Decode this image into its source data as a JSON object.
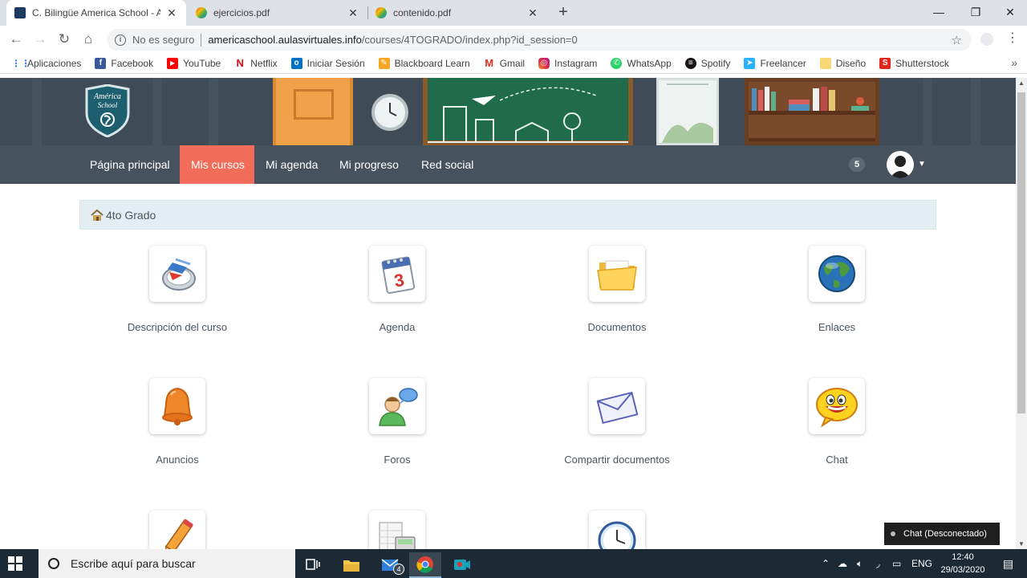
{
  "browser": {
    "tabs": [
      {
        "title": "C. Bilingüe America School - Ame",
        "active": true
      },
      {
        "title": "ejercicios.pdf",
        "active": false
      },
      {
        "title": "contenido.pdf",
        "active": false
      }
    ],
    "omnibox": {
      "security_label": "No es seguro",
      "host": "americaschool.aulasvirtuales.info",
      "path": "/courses/4TOGRADO/index.php?id_session=0"
    },
    "bookmarks": [
      {
        "label": "Aplicaciones",
        "icon": "apps-icon",
        "color": "#4285f4"
      },
      {
        "label": "Facebook",
        "icon": "facebook-icon",
        "color": "#3b5998"
      },
      {
        "label": "YouTube",
        "icon": "youtube-icon",
        "color": "#ff0000"
      },
      {
        "label": "Netflix",
        "icon": "netflix-icon",
        "color": "#e50914"
      },
      {
        "label": "Iniciar Sesión",
        "icon": "outlook-icon",
        "color": "#0072c6"
      },
      {
        "label": "Blackboard Learn",
        "icon": "blackboard-icon",
        "color": "#f5a623"
      },
      {
        "label": "Gmail",
        "icon": "gmail-icon",
        "color": "#d93025"
      },
      {
        "label": "Instagram",
        "icon": "instagram-icon",
        "color": "#c13584"
      },
      {
        "label": "WhatsApp",
        "icon": "whatsapp-icon",
        "color": "#25d366"
      },
      {
        "label": "Spotify",
        "icon": "spotify-icon",
        "color": "#191414"
      },
      {
        "label": "Freelancer",
        "icon": "freelancer-icon",
        "color": "#29b2fe"
      },
      {
        "label": "Diseño",
        "icon": "folder-icon",
        "color": "#f8d775"
      },
      {
        "label": "Shutterstock",
        "icon": "shutterstock-icon",
        "color": "#e1251b"
      }
    ]
  },
  "site": {
    "logo_text": "América School",
    "nav": [
      {
        "label": "Página principal",
        "active": false
      },
      {
        "label": "Mis cursos",
        "active": true
      },
      {
        "label": "Mi agenda",
        "active": false
      },
      {
        "label": "Mi progreso",
        "active": false
      },
      {
        "label": "Red social",
        "active": false
      }
    ],
    "notification_count": "5",
    "breadcrumb": "4to Grado",
    "tools": [
      {
        "label": "Descripción del curso",
        "icon": "compass-icon"
      },
      {
        "label": "Agenda",
        "icon": "calendar-icon",
        "icon_text": "3"
      },
      {
        "label": "Documentos",
        "icon": "folder-icon"
      },
      {
        "label": "Enlaces",
        "icon": "globe-icon"
      },
      {
        "label": "Anuncios",
        "icon": "bell-icon"
      },
      {
        "label": "Foros",
        "icon": "forum-icon"
      },
      {
        "label": "Compartir documentos",
        "icon": "envelope-icon"
      },
      {
        "label": "Chat",
        "icon": "smiley-icon"
      },
      {
        "label": "",
        "icon": "pencil-icon"
      },
      {
        "label": "",
        "icon": "calculator-icon"
      },
      {
        "label": "",
        "icon": "clock-icon"
      }
    ],
    "chat_status": "Chat (Desconectado)"
  },
  "taskbar": {
    "search_placeholder": "Escribe aquí para buscar",
    "mail_badge": "4",
    "language": "ENG",
    "time": "12:40",
    "date": "29/03/2020"
  },
  "colors": {
    "nav_bg": "#46535f",
    "nav_active": "#f26c5a",
    "breadcrumb_bg": "#e3eef2"
  }
}
